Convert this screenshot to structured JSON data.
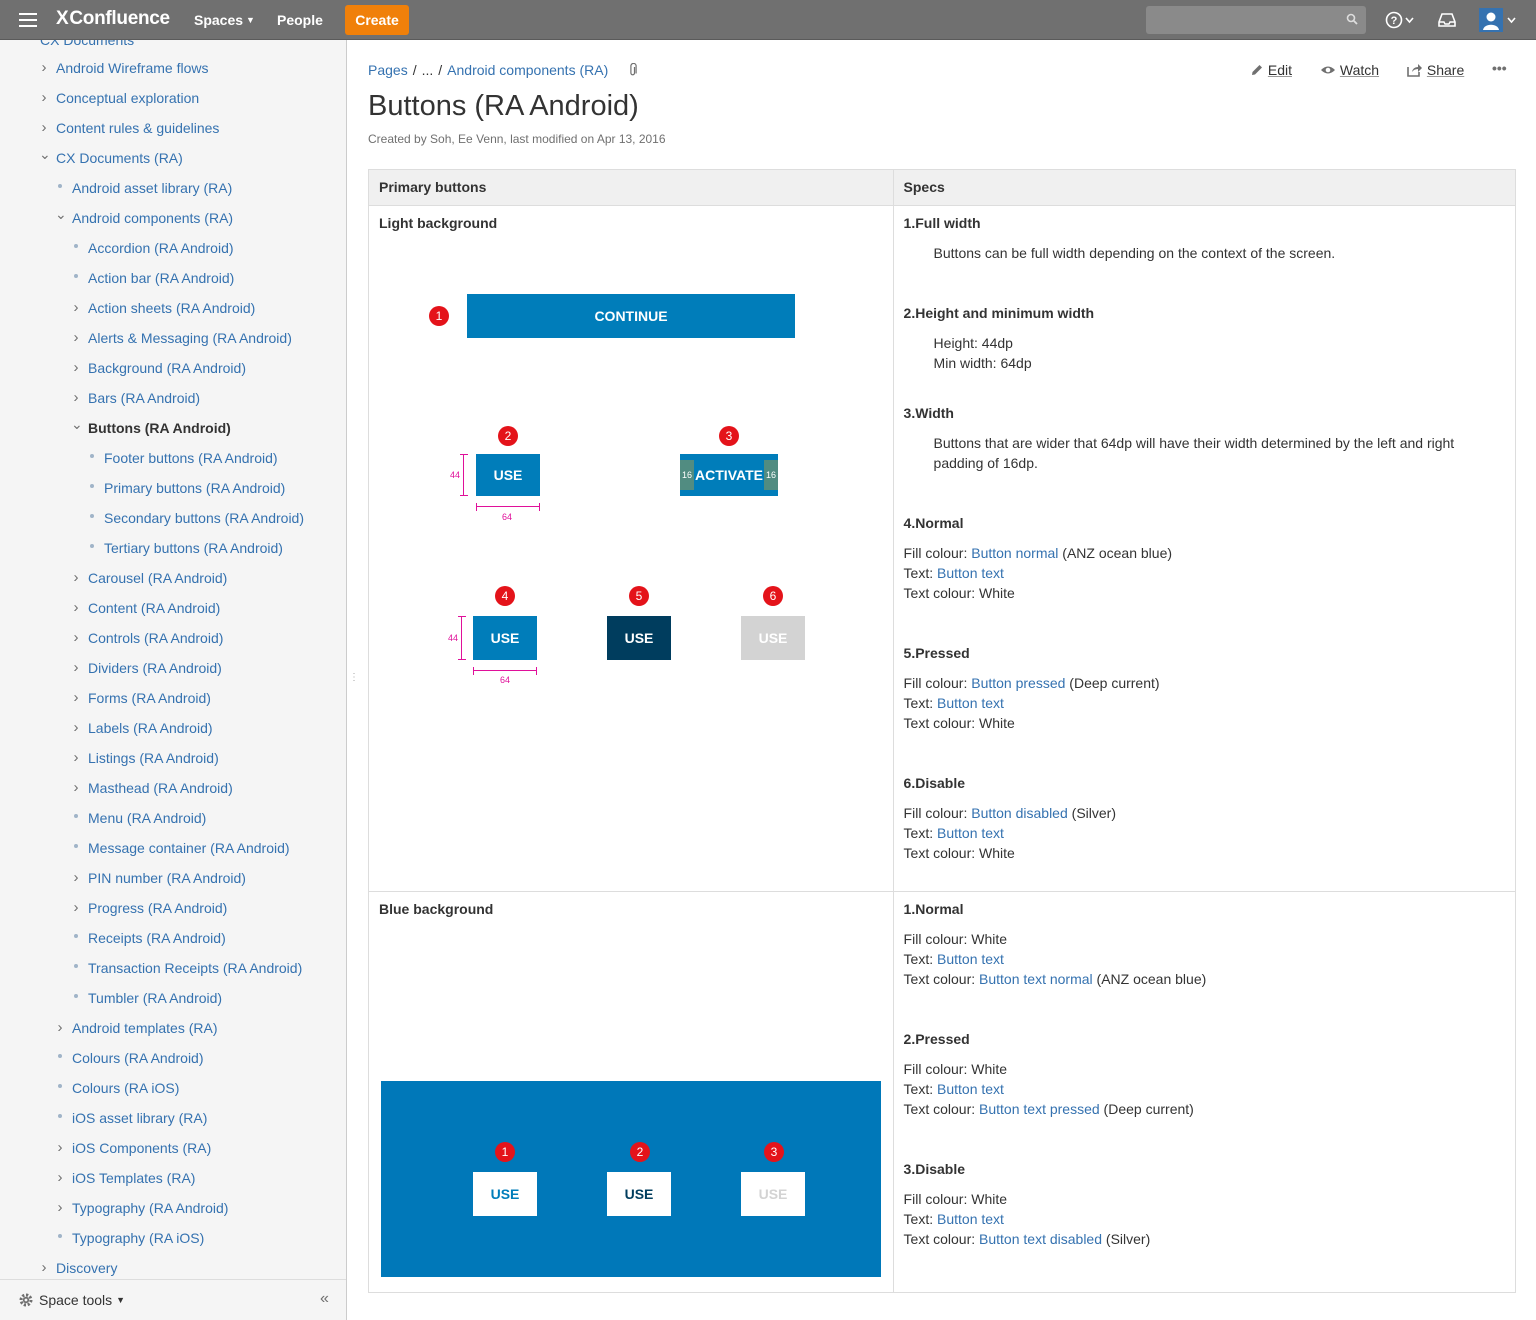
{
  "topnav": {
    "logo": "Confluence",
    "logo_x": "X",
    "spaces": "Spaces",
    "people": "People",
    "create": "Create",
    "search_placeholder": ""
  },
  "sidebar": {
    "cut_item": "CX Documents",
    "items": [
      {
        "label": "Android Wireframe flows",
        "marker": "chevron"
      },
      {
        "label": "Conceptual exploration",
        "marker": "chevron"
      },
      {
        "label": "Content rules & guidelines",
        "marker": "chevron"
      },
      {
        "label": "CX Documents (RA)",
        "marker": "expanded"
      },
      {
        "label": "Android asset library (RA)",
        "marker": "dot"
      },
      {
        "label": "Android components (RA)",
        "marker": "expanded"
      },
      {
        "label": "Accordion (RA Android)",
        "marker": "dot"
      },
      {
        "label": "Action bar (RA Android)",
        "marker": "dot"
      },
      {
        "label": "Action sheets (RA Android)",
        "marker": "chevron"
      },
      {
        "label": "Alerts & Messaging (RA Android)",
        "marker": "chevron"
      },
      {
        "label": "Background (RA Android)",
        "marker": "chevron"
      },
      {
        "label": "Bars (RA Android)",
        "marker": "chevron"
      },
      {
        "label": "Buttons (RA Android)",
        "marker": "expanded",
        "current": true
      },
      {
        "label": "Footer buttons (RA Android)",
        "marker": "dot"
      },
      {
        "label": "Primary buttons (RA Android)",
        "marker": "dot"
      },
      {
        "label": "Secondary buttons (RA Android)",
        "marker": "dot"
      },
      {
        "label": "Tertiary buttons (RA Android)",
        "marker": "dot"
      },
      {
        "label": "Carousel (RA Android)",
        "marker": "chevron"
      },
      {
        "label": "Content (RA Android)",
        "marker": "chevron"
      },
      {
        "label": "Controls (RA Android)",
        "marker": "chevron"
      },
      {
        "label": "Dividers (RA Android)",
        "marker": "chevron"
      },
      {
        "label": "Forms (RA Android)",
        "marker": "chevron"
      },
      {
        "label": "Labels (RA Android)",
        "marker": "chevron"
      },
      {
        "label": "Listings (RA Android)",
        "marker": "chevron"
      },
      {
        "label": "Masthead (RA Android)",
        "marker": "chevron"
      },
      {
        "label": "Menu (RA Android)",
        "marker": "dot"
      },
      {
        "label": "Message container (RA Android)",
        "marker": "dot"
      },
      {
        "label": "PIN number (RA Android)",
        "marker": "chevron"
      },
      {
        "label": "Progress (RA Android)",
        "marker": "chevron"
      },
      {
        "label": "Receipts (RA Android)",
        "marker": "dot"
      },
      {
        "label": "Transaction Receipts (RA Android)",
        "marker": "dot"
      },
      {
        "label": "Tumbler (RA Android)",
        "marker": "dot"
      },
      {
        "label": "Android templates (RA)",
        "marker": "chevron"
      },
      {
        "label": "Colours (RA Android)",
        "marker": "dot"
      },
      {
        "label": "Colours (RA iOS)",
        "marker": "dot"
      },
      {
        "label": "iOS asset library (RA)",
        "marker": "dot"
      },
      {
        "label": "iOS Components (RA)",
        "marker": "chevron"
      },
      {
        "label": "iOS Templates (RA)",
        "marker": "chevron"
      },
      {
        "label": "Typography (RA Android)",
        "marker": "chevron"
      },
      {
        "label": "Typography (RA iOS)",
        "marker": "dot"
      },
      {
        "label": "Discovery",
        "marker": "chevron"
      }
    ],
    "space_tools": "Space tools"
  },
  "breadcrumb": {
    "pages": "Pages",
    "sep1": "/",
    "ellipsis": "...",
    "sep2": "/",
    "parent": "Android components (RA)"
  },
  "actions": {
    "edit": "Edit",
    "watch": "Watch",
    "share": "Share",
    "more": "•••"
  },
  "page": {
    "title": "Buttons (RA Android)",
    "byline": "Created by Soh, Ee Venn, last modified on Apr 13, 2016"
  },
  "table": {
    "headers": [
      "Primary buttons",
      "Specs"
    ],
    "light": {
      "title": "Light background",
      "badges": [
        "1",
        "2",
        "3",
        "4",
        "5",
        "6"
      ],
      "continue": "CONTINUE",
      "use": "USE",
      "activate": "ACTIVATE",
      "dim_height": "44",
      "dim_width": "64",
      "pad": "16"
    },
    "blue": {
      "title": "Blue background",
      "badges": [
        "1",
        "2",
        "3"
      ],
      "use": "USE"
    },
    "specs_light": {
      "s1_title": "1.Full width",
      "s1_text": "Buttons can be full width depending on the context of the screen.",
      "s2_title": "2.Height and minimum width",
      "s2_line1": "Height: 44dp",
      "s2_line2": "Min width: 64dp",
      "s3_title": "3.Width",
      "s3_line1": "Buttons that are wider that 64dp will have their width determined by the left and right",
      "s3_line2": "padding of 16dp.",
      "s4_title": "4.Normal",
      "s4_fill_label": "Fill colour: ",
      "s4_fill_link": "Button normal",
      "s4_fill_note": " (ANZ ocean blue)",
      "s4_text_label": "Text: ",
      "s4_text_link": "Button text",
      "s4_colour": "Text colour: White",
      "s5_title": "5.Pressed",
      "s5_fill_label": "Fill colour: ",
      "s5_fill_link": "Button pressed",
      "s5_fill_note": " (Deep current)",
      "s5_text_label": "Text: ",
      "s5_text_link": "Button text",
      "s5_colour": "Text colour: White",
      "s6_title": "6.Disable",
      "s6_fill_label": "Fill colour: ",
      "s6_fill_link": "Button disabled",
      "s6_fill_note": " (Silver)",
      "s6_text_label": "Text: ",
      "s6_text_link": "Button text",
      "s6_colour": "Text colour: White"
    },
    "specs_blue": {
      "s1_title": "1.Normal",
      "s1_fill": "Fill colour: White",
      "s1_text_label": "Text: ",
      "s1_text_link": "Button text",
      "s1_colour_label": "Text colour: ",
      "s1_colour_link": "Button text normal",
      "s1_colour_note": " (ANZ ocean blue)",
      "s2_title": "2.Pressed",
      "s2_fill": "Fill colour: White",
      "s2_text_label": "Text: ",
      "s2_text_link": "Button text",
      "s2_colour_label": "Text colour: ",
      "s2_colour_link": "Button text pressed",
      "s2_colour_note": " (Deep current)",
      "s3_title": "3.Disable",
      "s3_fill": "Fill colour: White",
      "s3_text_label": "Text: ",
      "s3_text_link": "Button text",
      "s3_colour_label": "Text colour: ",
      "s3_colour_link": "Button text disabled",
      "s3_colour_note": " (Silver)"
    }
  },
  "colors": {
    "ocean_blue": "#007dba",
    "deep_current": "#003d5e",
    "silver": "#d3d3d3",
    "create_orange": "#f0800a",
    "link": "#3572b0",
    "badge_red": "#e4131a"
  }
}
